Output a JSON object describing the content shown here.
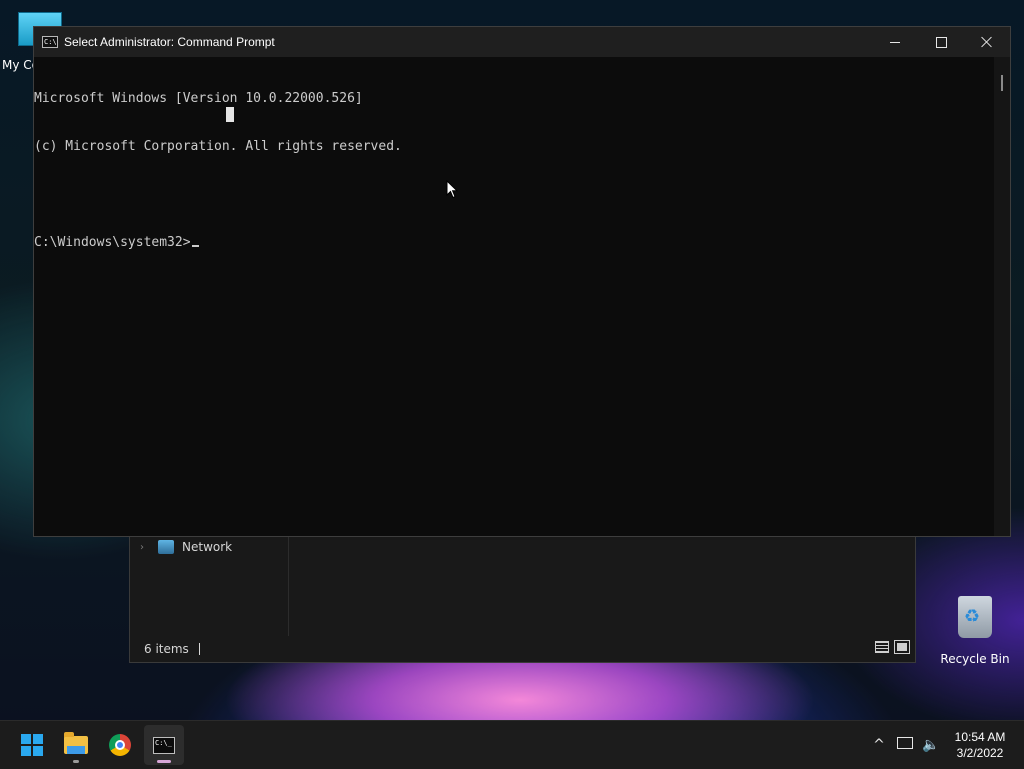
{
  "desktop": {
    "icons": [
      {
        "label": "My Co"
      },
      {
        "label": "Recycle Bin"
      }
    ]
  },
  "explorer": {
    "nav_item": "Network",
    "status_count": "6 items"
  },
  "cmd": {
    "title": "Select Administrator: Command Prompt",
    "lines": [
      "Microsoft Windows [Version 10.0.22000.526]",
      "(c) Microsoft Corporation. All rights reserved.",
      "",
      "C:\\Windows\\system32>"
    ]
  },
  "taskbar": {
    "apps": [
      "start",
      "file-explorer",
      "chrome",
      "command-prompt"
    ],
    "time": "10:54 AM",
    "date": "3/2/2022"
  },
  "colors": {
    "accent": "#2aa8ef",
    "console_bg": "#0c0c0c",
    "console_text": "#cccccc"
  }
}
